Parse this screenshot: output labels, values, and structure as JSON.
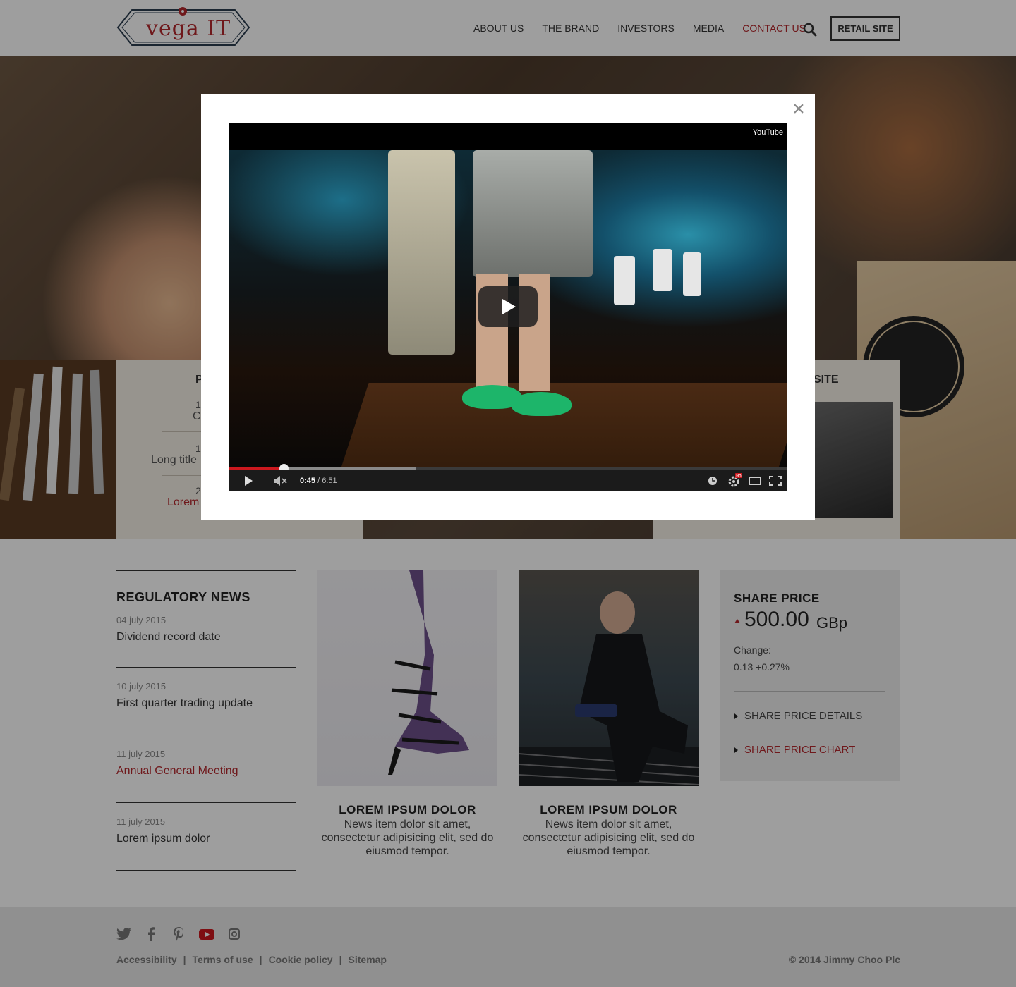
{
  "header": {
    "logo_text": "vega IT",
    "nav": [
      {
        "label": "ABOUT US"
      },
      {
        "label": "THE BRAND"
      },
      {
        "label": "INVESTORS"
      },
      {
        "label": "MEDIA"
      },
      {
        "label": "CONTACT US",
        "active": true
      }
    ],
    "retail_label": "RETAIL SITE"
  },
  "hero": {
    "panel_left": {
      "title": "P",
      "lines": [
        "1",
        "C",
        "1",
        "Long title",
        "2",
        "Lorem"
      ]
    },
    "panel_right": {
      "title": "SITE"
    }
  },
  "modal": {
    "close_symbol": "×",
    "video": {
      "brand": "YouTube",
      "current_time": "0:45",
      "duration": "/ 6:51",
      "played_fraction": 0.0974,
      "buffered_fraction": 0.335,
      "hd_badge": "HD"
    }
  },
  "regulatory_news": {
    "title": "REGULATORY NEWS",
    "items": [
      {
        "date": "04 july 2015",
        "title": "Dividend record date"
      },
      {
        "date": "10 july 2015",
        "title": "First quarter trading update"
      },
      {
        "date": "11 july 2015",
        "title": "Annual General Meeting",
        "highlight": true
      },
      {
        "date": "11 july 2015",
        "title": "Lorem ipsum dolor"
      }
    ]
  },
  "cards": [
    {
      "title": "LOREM IPSUM DOLOR",
      "body": "News item dolor sit amet, consectetur adipisicing elit, sed do eiusmod tempor."
    },
    {
      "title": "LOREM IPSUM DOLOR",
      "body": "News item dolor sit amet, consectetur adipisicing elit, sed do eiusmod tempor."
    }
  ],
  "share_price": {
    "title": "SHARE PRICE",
    "value": "500.00",
    "unit": "GBp",
    "change_label": "Change:",
    "change_value": "0.13  +0.27%",
    "links": [
      "SHARE PRICE DETAILS",
      "SHARE PRICE CHART"
    ]
  },
  "footer": {
    "social_icons": [
      "twitter-icon",
      "facebook-icon",
      "pinterest-icon",
      "youtube-icon",
      "instagram-icon"
    ],
    "links": [
      "Accessibility",
      "Terms of use",
      "Cookie policy",
      "Sitemap"
    ],
    "separator": "|",
    "copyright": "© 2014 Jimmy Choo Plc"
  },
  "colors": {
    "accent": "#b3272d",
    "text": "#333333",
    "youtube_red": "#cc181e"
  }
}
